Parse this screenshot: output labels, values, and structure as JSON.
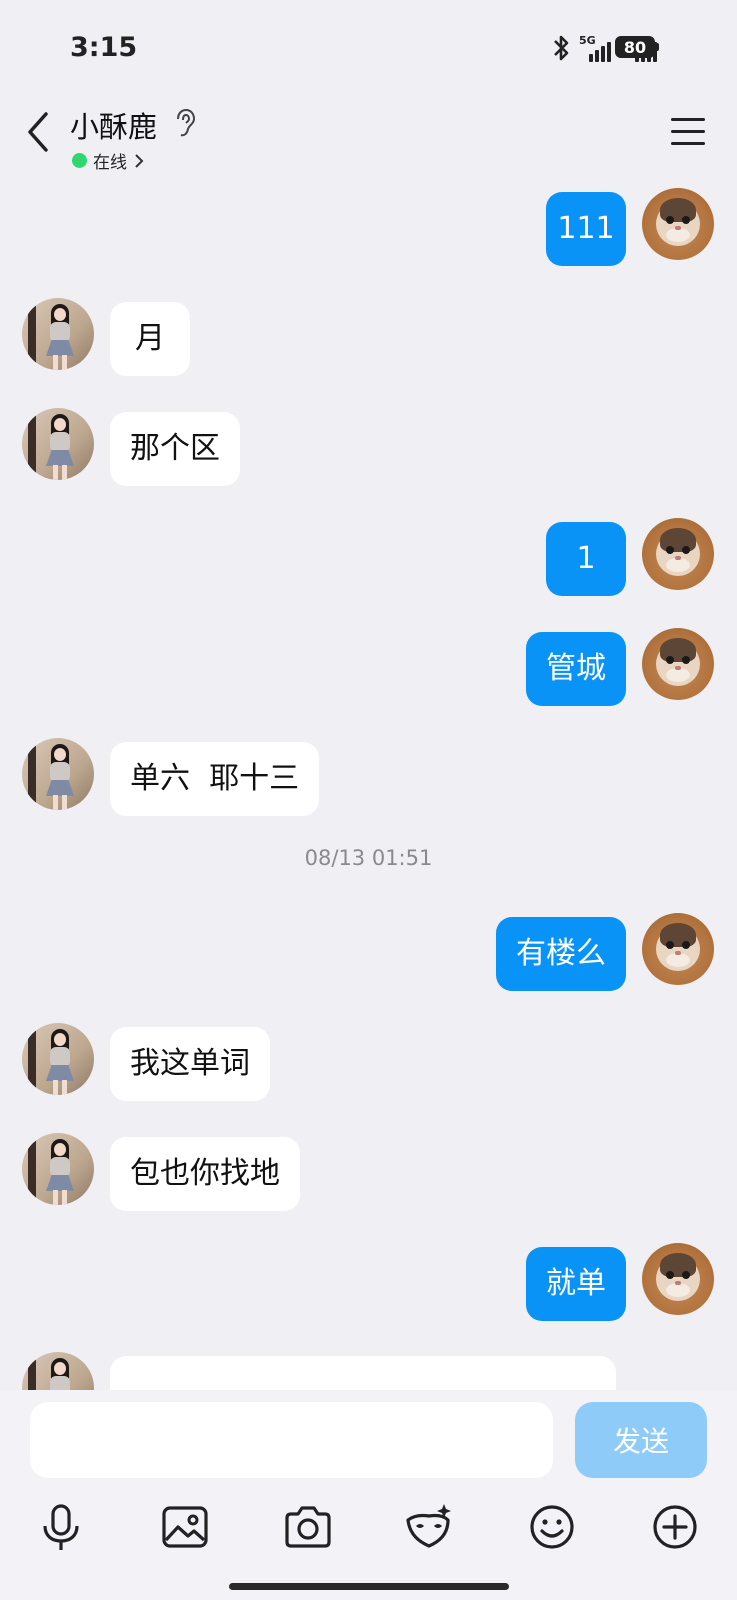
{
  "status_bar": {
    "time": "3:15",
    "network_1": "5G",
    "network_2": "5G",
    "battery": "80"
  },
  "header": {
    "contact_name": "小酥鹿",
    "online_status": "在线",
    "online_color": "#2dd86f"
  },
  "messages": [
    {
      "side": "right",
      "text": "111"
    },
    {
      "side": "left",
      "text": "月"
    },
    {
      "side": "left",
      "text": "那个区"
    },
    {
      "side": "right",
      "text": "1"
    },
    {
      "side": "right",
      "text": "管城"
    },
    {
      "side": "left",
      "text": "单六  耶十三"
    },
    {
      "timestamp": "08/13 01:51"
    },
    {
      "side": "right",
      "text": "有楼么"
    },
    {
      "side": "left",
      "text": "我这单词"
    },
    {
      "side": "left",
      "text": "包也你找地"
    },
    {
      "side": "right",
      "text": "就单"
    }
  ],
  "input": {
    "value": "",
    "placeholder": "",
    "send_label": "发送"
  },
  "toolbar": [
    "microphone-icon",
    "image-icon",
    "camera-icon",
    "mask-icon",
    "emoji-icon",
    "plus-icon"
  ],
  "colors": {
    "accent": "#0a93f7",
    "send_disabled": "#8ecbf9",
    "background": "#efeff4"
  }
}
